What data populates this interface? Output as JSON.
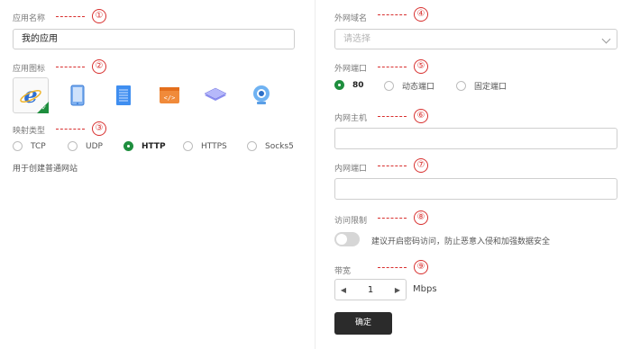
{
  "left": {
    "app_name": {
      "label": "应用名称",
      "value": "我的应用",
      "anno": "①"
    },
    "app_icon": {
      "label": "应用图标",
      "anno": "②",
      "icons": [
        "ie-icon",
        "tablet-icon",
        "document-icon",
        "code-icon",
        "layers-icon",
        "webcam-icon"
      ]
    },
    "map_type": {
      "label": "映射类型",
      "anno": "③",
      "options": [
        "TCP",
        "UDP",
        "HTTP",
        "HTTPS",
        "Socks5"
      ],
      "selected": "HTTP",
      "hint": "用于创建普通网站"
    }
  },
  "right": {
    "domain": {
      "label": "外网域名",
      "placeholder": "请选择",
      "anno": "④"
    },
    "ext_port": {
      "label": "外网端口",
      "anno": "⑤",
      "options": [
        "80",
        "动态端口",
        "固定端口"
      ],
      "selected": "80"
    },
    "host": {
      "label": "内网主机",
      "anno": "⑥",
      "value": ""
    },
    "int_port": {
      "label": "内网端口",
      "anno": "⑦",
      "value": ""
    },
    "access": {
      "label": "访问限制",
      "anno": "⑧",
      "hint": "建议开启密码访问，防止恶意入侵和加强数据安全",
      "enabled": false
    },
    "bandwidth": {
      "label": "带宽",
      "anno": "⑨",
      "value": "1",
      "unit": "Mbps"
    },
    "submit": "确定"
  },
  "colors": {
    "accent": "#1e8e3e",
    "annotation": "#d8302f",
    "button": "#2b2b2b"
  }
}
